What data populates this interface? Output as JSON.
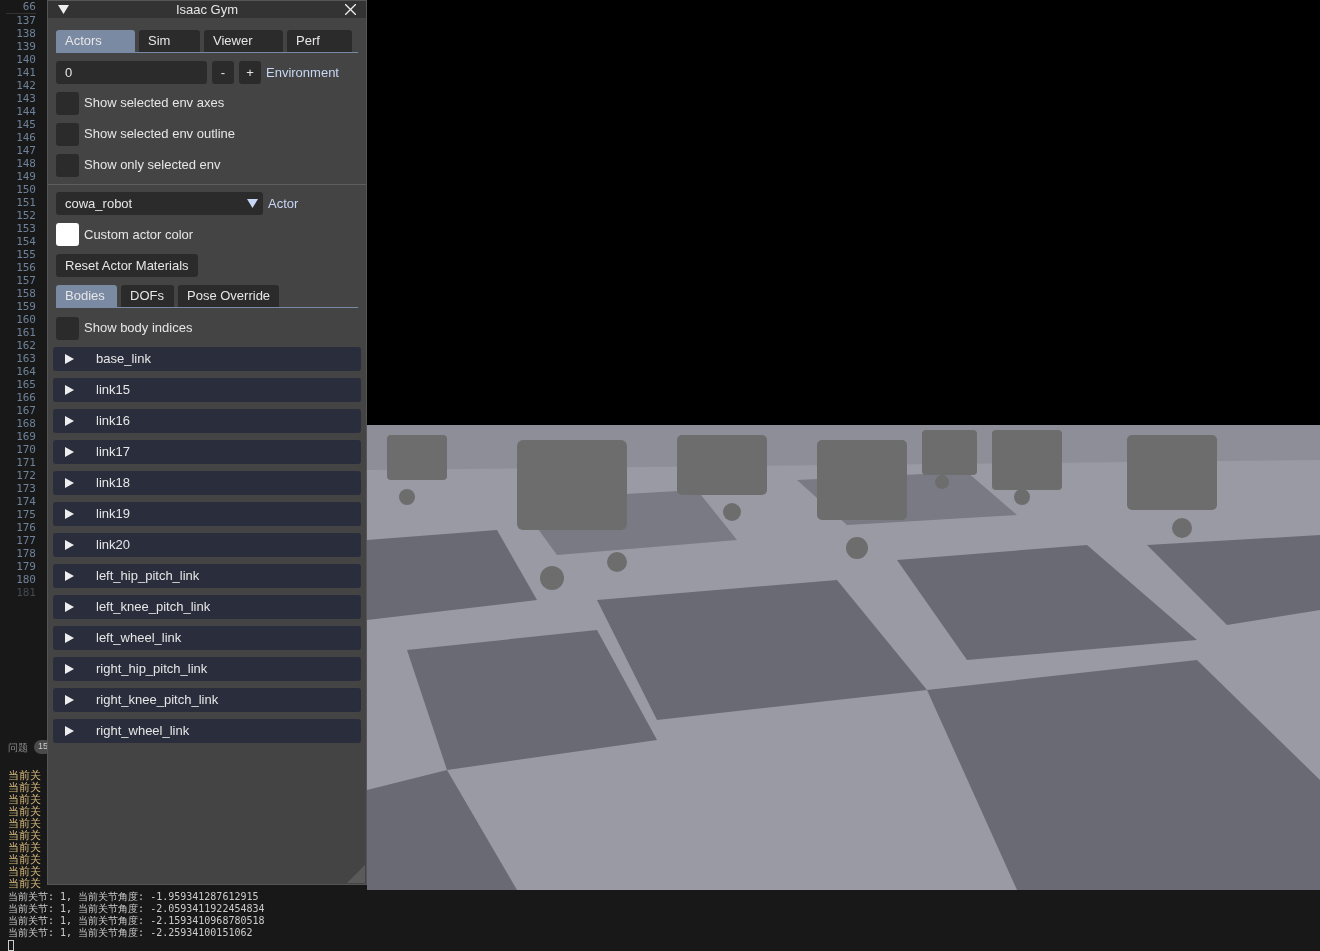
{
  "editor": {
    "line_numbers": [
      {
        "text": "66",
        "dim": false
      },
      {
        "text": "137",
        "dim": false
      },
      {
        "text": "138",
        "dim": false
      },
      {
        "text": "139",
        "dim": false
      },
      {
        "text": "140",
        "dim": false
      },
      {
        "text": "141",
        "dim": false
      },
      {
        "text": "142",
        "dim": false
      },
      {
        "text": "143",
        "dim": false
      },
      {
        "text": "144",
        "dim": false
      },
      {
        "text": "145",
        "dim": false
      },
      {
        "text": "146",
        "dim": false
      },
      {
        "text": "147",
        "dim": false
      },
      {
        "text": "148",
        "dim": false
      },
      {
        "text": "149",
        "dim": false
      },
      {
        "text": "150",
        "dim": false
      },
      {
        "text": "151",
        "dim": false
      },
      {
        "text": "152",
        "dim": false
      },
      {
        "text": "153",
        "dim": false
      },
      {
        "text": "154",
        "dim": false
      },
      {
        "text": "155",
        "dim": false
      },
      {
        "text": "156",
        "dim": false
      },
      {
        "text": "157",
        "dim": false
      },
      {
        "text": "158",
        "dim": false
      },
      {
        "text": "159",
        "dim": false
      },
      {
        "text": "160",
        "dim": false
      },
      {
        "text": "161",
        "dim": false
      },
      {
        "text": "162",
        "dim": false
      },
      {
        "text": "163",
        "dim": false
      },
      {
        "text": "164",
        "dim": false
      },
      {
        "text": "165",
        "dim": false
      },
      {
        "text": "166",
        "dim": false
      },
      {
        "text": "167",
        "dim": false
      },
      {
        "text": "168",
        "dim": false
      },
      {
        "text": "169",
        "dim": false
      },
      {
        "text": "170",
        "dim": false
      },
      {
        "text": "171",
        "dim": false
      },
      {
        "text": "172",
        "dim": false
      },
      {
        "text": "173",
        "dim": false
      },
      {
        "text": "174",
        "dim": false
      },
      {
        "text": "175",
        "dim": false
      },
      {
        "text": "176",
        "dim": false
      },
      {
        "text": "177",
        "dim": false
      },
      {
        "text": "178",
        "dim": false
      },
      {
        "text": "179",
        "dim": false
      },
      {
        "text": "180",
        "dim": false
      },
      {
        "text": "181",
        "dim": true
      }
    ]
  },
  "bottom_panel": {
    "tab": "问题",
    "badge": "15",
    "terminal_lines": [
      "当前关",
      "当前关",
      "当前关",
      "当前关",
      "当前关",
      "当前关",
      "当前关",
      "当前关",
      "当前关",
      "当前关",
      "当前关节: 1, 当前关节角度: -1.959341287612915",
      "当前关节: 1, 当前关节角度: -2.0593411922454834",
      "当前关节: 1, 当前关节角度: -2.1593410968780518",
      "当前关节: 1, 当前关节角度: -2.25934100151062"
    ]
  },
  "panel": {
    "title": "Isaac Gym",
    "tabs": [
      {
        "label": "Actors",
        "selected": true
      },
      {
        "label": "Sim",
        "selected": false
      },
      {
        "label": "Viewer",
        "selected": false
      },
      {
        "label": "Perf",
        "selected": false
      }
    ],
    "environment": {
      "value": "0",
      "minus": "-",
      "plus": "+",
      "label": "Environment"
    },
    "env_options": [
      {
        "label": "Show selected env axes",
        "checked": false
      },
      {
        "label": "Show selected env outline",
        "checked": false
      },
      {
        "label": "Show only selected env",
        "checked": false
      }
    ],
    "actor": {
      "value": "cowa_robot",
      "label": "Actor"
    },
    "custom_color": {
      "label": "Custom actor color"
    },
    "reset_button": "Reset Actor Materials",
    "subtabs": [
      {
        "label": "Bodies",
        "selected": true
      },
      {
        "label": "DOFs",
        "selected": false
      },
      {
        "label": "Pose Override",
        "selected": false
      }
    ],
    "show_body_indices": {
      "label": "Show body indices",
      "checked": false
    },
    "bodies": [
      {
        "label": "base_link",
        "expanded": false
      },
      {
        "label": "link15",
        "expanded": false
      },
      {
        "label": "link16",
        "expanded": false
      },
      {
        "label": "link17",
        "expanded": false
      },
      {
        "label": "link18",
        "expanded": false
      },
      {
        "label": "link19",
        "expanded": false
      },
      {
        "label": "link20",
        "expanded": false
      },
      {
        "label": "left_hip_pitch_link",
        "expanded": false
      },
      {
        "label": "left_knee_pitch_link",
        "expanded": false
      },
      {
        "label": "left_wheel_link",
        "expanded": false
      },
      {
        "label": "right_hip_pitch_link",
        "expanded": false
      },
      {
        "label": "right_knee_pitch_link",
        "expanded": false
      },
      {
        "label": "right_wheel_link",
        "expanded": false
      }
    ]
  }
}
